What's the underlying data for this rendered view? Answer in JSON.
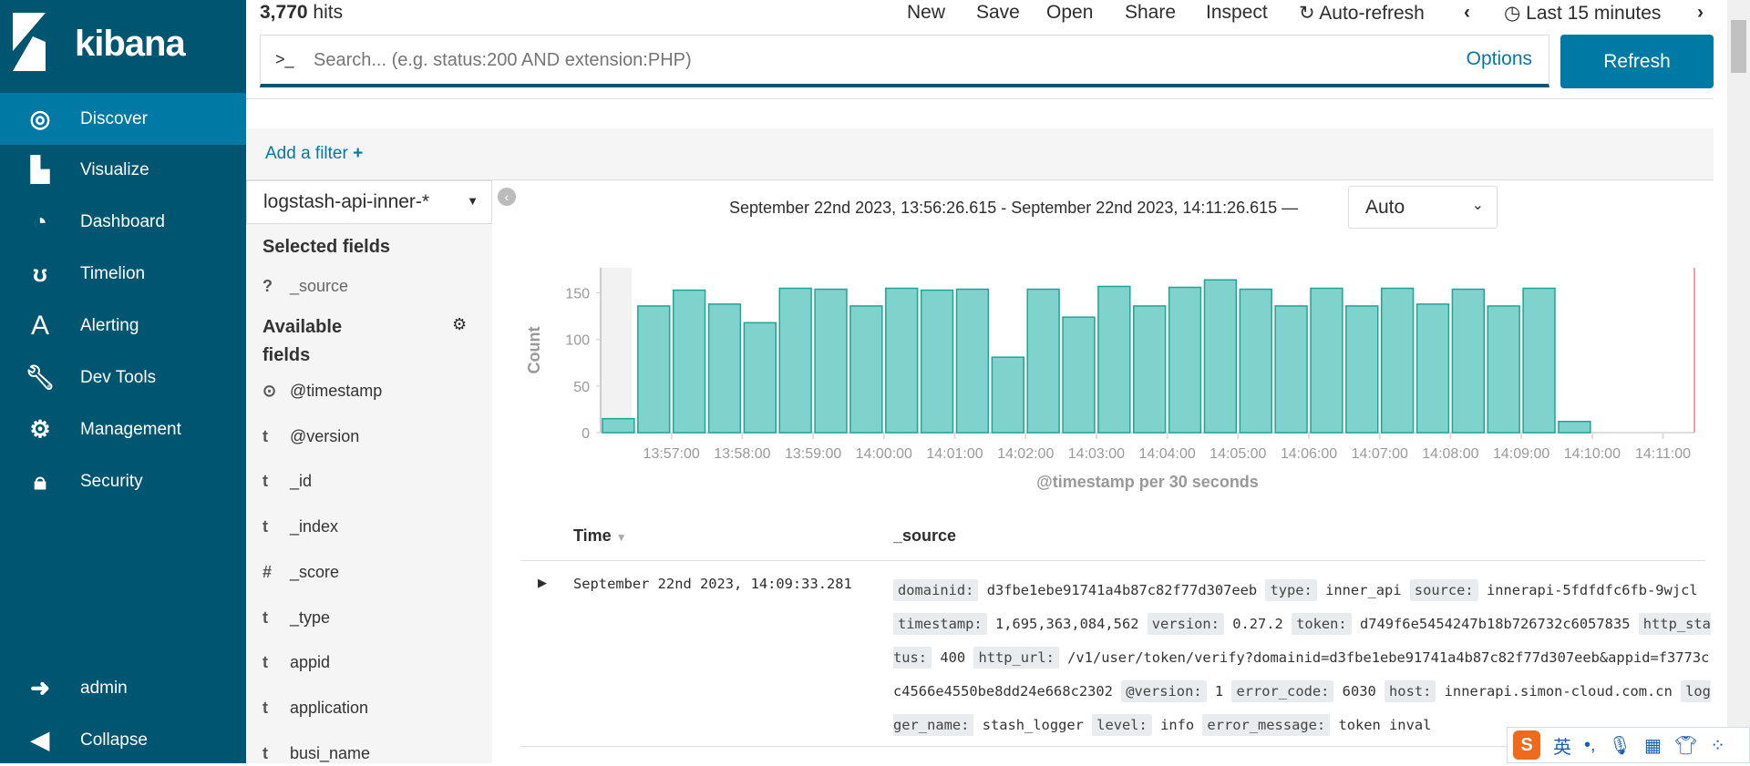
{
  "brand": {
    "name": "kibana"
  },
  "sidebar": {
    "items": [
      {
        "label": "Discover",
        "icon": "compass-icon",
        "active": true
      },
      {
        "label": "Visualize",
        "icon": "bar-chart-icon"
      },
      {
        "label": "Dashboard",
        "icon": "dashboard-icon"
      },
      {
        "label": "Timelion",
        "icon": "bear-icon"
      },
      {
        "label": "Alerting",
        "icon": "alerting-a-icon"
      },
      {
        "label": "Dev Tools",
        "icon": "wrench-icon"
      },
      {
        "label": "Management",
        "icon": "gear-icon"
      },
      {
        "label": "Security",
        "icon": "lock-icon"
      }
    ],
    "user": "admin",
    "collapse": "Collapse"
  },
  "header": {
    "hits_count": "3,770",
    "hits_label": " hits",
    "menu": [
      "New",
      "Save",
      "Open",
      "Share",
      "Inspect",
      "Auto-refresh",
      "Last 15 minutes"
    ]
  },
  "search": {
    "prompt": ">_",
    "placeholder": "Search... (e.g. status:200 AND extension:PHP)",
    "options": "Options",
    "refresh": "Refresh"
  },
  "filter": {
    "add": "Add a filter"
  },
  "fields": {
    "index": "logstash-api-inner-*",
    "selected_title": "Selected fields",
    "selected": [
      {
        "type": "?",
        "name": "_source"
      }
    ],
    "available_title": "Available fields",
    "available": [
      {
        "type": "⊙",
        "name": "@timestamp"
      },
      {
        "type": "t",
        "name": "@version"
      },
      {
        "type": "t",
        "name": "_id"
      },
      {
        "type": "t",
        "name": "_index"
      },
      {
        "type": "#",
        "name": "_score"
      },
      {
        "type": "t",
        "name": "_type"
      },
      {
        "type": "t",
        "name": "appid"
      },
      {
        "type": "t",
        "name": "application"
      },
      {
        "type": "t",
        "name": "busi_name"
      }
    ]
  },
  "timerange": {
    "text": "September 22nd 2023, 13:56:26.615 - September 22nd 2023, 14:11:26.615 —",
    "interval": "Auto"
  },
  "chart_data": {
    "type": "bar",
    "title": "",
    "xlabel": "@timestamp per 30 seconds",
    "ylabel": "Count",
    "ylim": [
      0,
      177
    ],
    "yticks": [
      0,
      50,
      100,
      150
    ],
    "xlim": [
      "13:56:00",
      "14:11:26.615"
    ],
    "xticks": [
      "13:57:00",
      "13:58:00",
      "13:59:00",
      "14:00:00",
      "14:01:00",
      "14:02:00",
      "14:03:00",
      "14:04:00",
      "14:05:00",
      "14:06:00",
      "14:07:00",
      "14:08:00",
      "14:09:00",
      "14:10:00",
      "14:11:00"
    ],
    "categories": [
      "13:56:00",
      "13:56:30",
      "13:57:00",
      "13:57:30",
      "13:58:00",
      "13:58:30",
      "13:59:00",
      "13:59:30",
      "14:00:00",
      "14:00:30",
      "14:01:00",
      "14:01:30",
      "14:02:00",
      "14:02:30",
      "14:03:00",
      "14:03:30",
      "14:04:00",
      "14:04:30",
      "14:05:00",
      "14:05:30",
      "14:06:00",
      "14:06:30",
      "14:07:00",
      "14:07:30",
      "14:08:00",
      "14:08:30",
      "14:09:00",
      "14:09:30"
    ],
    "values": [
      15,
      136,
      153,
      138,
      118,
      155,
      154,
      136,
      155,
      153,
      154,
      81,
      154,
      124,
      157,
      136,
      156,
      164,
      154,
      136,
      155,
      136,
      155,
      138,
      154,
      136,
      155,
      12
    ],
    "colors": {
      "fill": "#80d3cc",
      "stroke": "#1fa397",
      "out_of_range": "#f2f2f2",
      "now_line": "#f0a0a8"
    }
  },
  "table": {
    "headers": [
      "Time",
      "_source"
    ],
    "rows": [
      {
        "time": "September 22nd 2023, 14:09:33.281",
        "source": [
          [
            "domainid:",
            "d3fbe1ebe91741a4b87c82f77d307eeb"
          ],
          [
            "type:",
            "inner_api"
          ],
          [
            "source:",
            "innerapi-5fdfdfc6fb-9wjcl"
          ],
          [
            "timestamp:",
            "1,695,363,084,562"
          ],
          [
            "version:",
            "0.27.2"
          ],
          [
            "token:",
            "d749f6e5454247b18b726732c6057835"
          ],
          [
            "http_status:",
            "400"
          ],
          [
            "http_url:",
            "/v1/user/token/verify?domainid=d3fbe1ebe91741a4b87c82f77d307eeb&appid=f3773cc4566e4550be8dd24e668c2302"
          ],
          [
            "@version:",
            "1"
          ],
          [
            "error_code:",
            "6030"
          ],
          [
            "host:",
            "innerapi.simon-cloud.com.cn"
          ],
          [
            "logger_name:",
            "stash_logger"
          ],
          [
            "level:",
            "info"
          ],
          [
            "error_message:",
            "token inval"
          ]
        ]
      }
    ]
  },
  "ime": {
    "lang": "英",
    "punct": "•,"
  }
}
